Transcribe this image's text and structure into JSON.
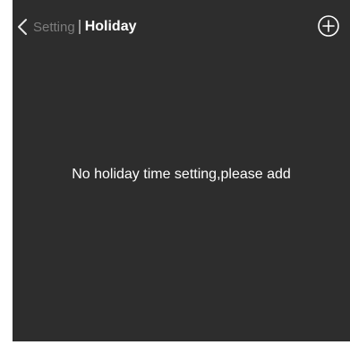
{
  "header": {
    "back_icon": "chevron-left-icon",
    "parent_label": "Setting",
    "title": "Holiday",
    "add_icon": "circle-plus-icon"
  },
  "main": {
    "empty_message": "No holiday time setting,please add"
  },
  "colors": {
    "background": "#2d2d2d",
    "parent_text": "#7c7c7c",
    "title_text": "#ffffff",
    "separator": "#9a9a9a"
  }
}
